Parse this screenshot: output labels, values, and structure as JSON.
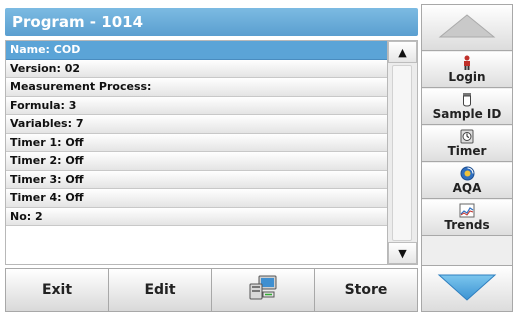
{
  "title": "Program - 1014",
  "list": {
    "rows": [
      "Name: COD",
      "Version: 02",
      "Measurement Process:",
      "Formula: 3",
      "Variables: 7",
      "Timer 1: Off",
      "Timer 2: Off",
      "Timer 3: Off",
      "Timer 4: Off",
      "No: 2"
    ],
    "selected_index": 0
  },
  "bottom": {
    "exit_label": "Exit",
    "edit_label": "Edit",
    "computer_icon": "computer-icon",
    "store_label": "Store"
  },
  "side": {
    "login_label": "Login",
    "sample_id_label": "Sample ID",
    "timer_label": "Timer",
    "aqa_label": "AQA",
    "trends_label": "Trends"
  },
  "colors": {
    "title_bar": "#6eb1de",
    "selected_row": "#5ba4d7",
    "arrow": "#5aaee0"
  }
}
